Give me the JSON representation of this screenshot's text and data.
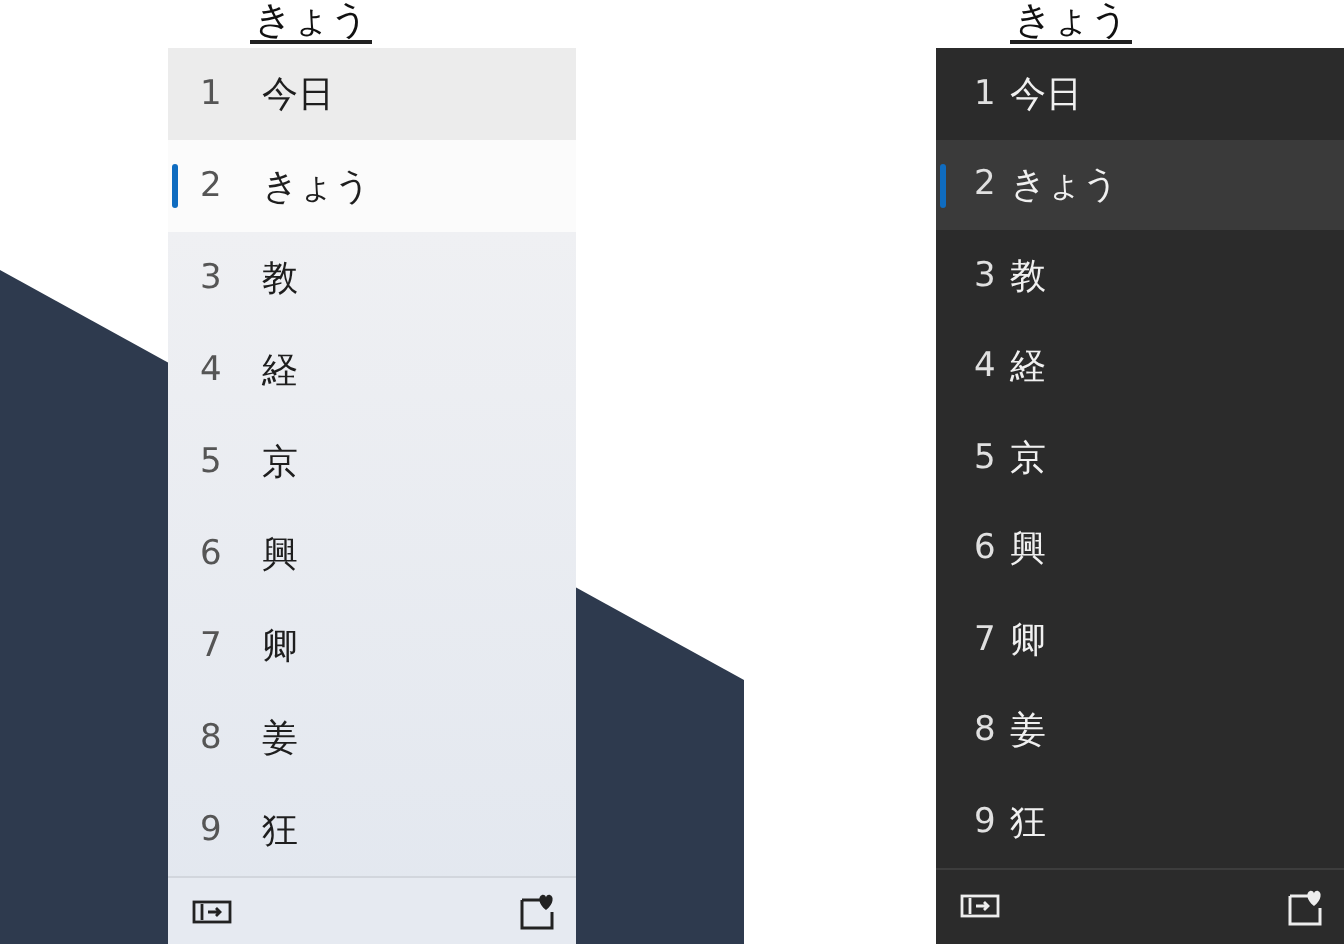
{
  "panels": [
    {
      "kind": "light",
      "composition": "きょう",
      "candidates": [
        {
          "number": "1",
          "text": "今日",
          "selected": false
        },
        {
          "number": "2",
          "text": "きょう",
          "selected": true
        },
        {
          "number": "3",
          "text": "教",
          "selected": false
        },
        {
          "number": "4",
          "text": "経",
          "selected": false
        },
        {
          "number": "5",
          "text": "京",
          "selected": false
        },
        {
          "number": "6",
          "text": "興",
          "selected": false
        },
        {
          "number": "7",
          "text": "卿",
          "selected": false
        },
        {
          "number": "8",
          "text": "姜",
          "selected": false
        },
        {
          "number": "9",
          "text": "狂",
          "selected": false
        }
      ]
    },
    {
      "kind": "dark",
      "composition": "きょう",
      "candidates": [
        {
          "number": "1",
          "text": "今日",
          "selected": false
        },
        {
          "number": "2",
          "text": "きょう",
          "selected": true
        },
        {
          "number": "3",
          "text": "教",
          "selected": false
        },
        {
          "number": "4",
          "text": "経",
          "selected": false
        },
        {
          "number": "5",
          "text": "京",
          "selected": false
        },
        {
          "number": "6",
          "text": "興",
          "selected": false
        },
        {
          "number": "7",
          "text": "卿",
          "selected": false
        },
        {
          "number": "8",
          "text": "姜",
          "selected": false
        },
        {
          "number": "9",
          "text": "狂",
          "selected": false
        }
      ]
    }
  ]
}
